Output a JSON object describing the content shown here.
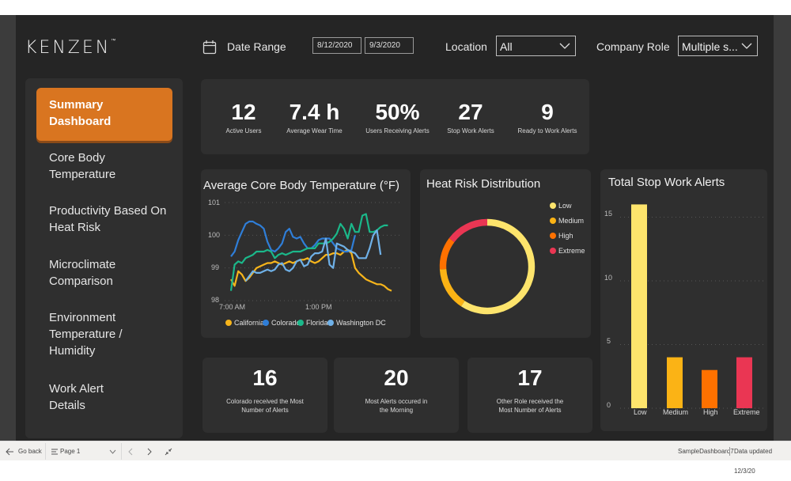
{
  "header": {
    "logo": "KENZEN",
    "logo_mark": "™",
    "date_range_label": "Date Range",
    "date_start": "8/12/2020",
    "date_end": "9/3/2020",
    "location_label": "Location",
    "location_value": "All",
    "role_label": "Company Role",
    "role_value": "Multiple s..."
  },
  "sidebar": {
    "items": [
      {
        "label": "Summary Dashboard",
        "active": true
      },
      {
        "label": "Core Body Temperature"
      },
      {
        "label": "Productivity Based On Heat Risk"
      },
      {
        "label": "Microclimate Comparison"
      },
      {
        "label": "Environment Temperature / Humidity"
      },
      {
        "label": "Work Alert Details"
      }
    ]
  },
  "kpis": [
    {
      "value": "12",
      "label": "Active Users"
    },
    {
      "value": "7.4 h",
      "label": "Average Wear Time"
    },
    {
      "value": "50%",
      "label": "Users Receiving Alerts"
    },
    {
      "value": "27",
      "label": "Stop Work Alerts"
    },
    {
      "value": "9",
      "label": "Ready to Work Alerts"
    }
  ],
  "insights": [
    {
      "value": "16",
      "label": "Colorado received the Most Number of Alerts"
    },
    {
      "value": "20",
      "label": "Most Alerts occured in the Morning"
    },
    {
      "value": "17",
      "label": "Other Role received the Most Number of Alerts"
    }
  ],
  "chart_data": [
    {
      "type": "line",
      "title": "Average Core Body Temperature (°F)",
      "xlabel": "",
      "ylabel": "",
      "ylim": [
        98,
        101
      ],
      "yticks": [
        "101",
        "100",
        "99",
        "98"
      ],
      "xticks": [
        "7:00 AM",
        "1:00 PM"
      ],
      "grid": true,
      "legend_position": "bottom",
      "series": [
        {
          "name": "California",
          "color": "#f7b51b",
          "values": [
            98.65,
            98.45,
            98.9,
            98.8,
            98.6,
            98.7,
            98.85,
            99.0,
            99.05,
            99.1,
            99.15,
            99.15,
            99.2,
            99.15,
            99.1,
            99.15,
            99.2,
            99.15,
            99.2,
            99.25,
            99.25,
            99.3,
            99.2,
            99.15,
            99.2,
            99.3,
            99.4,
            99.4,
            99.45,
            99.45,
            99.4,
            99.5,
            99.55,
            99.45,
            99.0,
            98.85,
            98.75,
            98.65,
            98.6,
            98.55,
            98.5,
            98.5,
            98.45,
            98.35,
            98.3
          ]
        },
        {
          "name": "Colorado",
          "color": "#2f7ed8",
          "values": [
            99.35,
            99.5,
            99.85,
            100.1,
            100.35,
            100.42,
            100.42,
            100.35,
            100.3,
            100.2,
            99.8,
            99.55,
            99.5,
            99.6,
            99.75,
            100.1,
            100.2,
            99.95,
            99.9,
            99.95,
            99.75,
            99.6,
            99.6,
            99.7,
            99.85,
            99.9,
            99.9,
            99.9,
            99.75,
            99.6,
            99.55,
            99.5,
            99.5,
            99.55,
            100.0,
            null,
            null,
            null,
            null,
            null,
            null,
            null,
            null,
            null,
            null
          ]
        },
        {
          "name": "Florida",
          "color": "#1bb88a",
          "values": [
            98.3,
            99.1,
            99.2,
            99.15,
            99.3,
            99.35,
            99.4,
            99.5,
            99.5,
            99.5,
            99.55,
            99.5,
            99.3,
            99.4,
            99.45,
            99.4,
            99.45,
            99.5,
            99.5,
            99.5,
            99.55,
            99.6,
            99.6,
            99.6,
            99.75,
            99.75,
            99.75,
            99.8,
            99.9,
            100.05,
            100.35,
            100.2,
            99.9,
            100.35,
            100.1,
            100.1,
            100.6,
            100.65,
            100.1,
            100.1,
            100.15,
            100.25,
            100.3,
            100.3,
            null
          ]
        },
        {
          "name": "Washington DC",
          "color": "#6fb1e8",
          "values": [
            null,
            null,
            null,
            null,
            98.6,
            98.75,
            98.9,
            98.85,
            98.85,
            98.9,
            98.95,
            98.9,
            98.95,
            99.1,
            99.15,
            98.95,
            98.9,
            99.0,
            99.2,
            99.25,
            99.05,
            99.1,
            99.35,
            99.45,
            99.45,
            99.5,
            99.9,
            99.1,
            99.0,
            99.75,
            99.7,
            99.65,
            99.55,
            99.5,
            99.45,
            99.3,
            99.3,
            99.3,
            99.6,
            100.0,
            100.15,
            99.4,
            null,
            null,
            null
          ]
        }
      ]
    },
    {
      "type": "pie",
      "title": "Heat Risk Distribution",
      "donut": true,
      "legend_position": "top-right",
      "categories": [
        "Low",
        "Medium",
        "High",
        "Extreme"
      ],
      "values": [
        16,
        4,
        3,
        4
      ],
      "colors": [
        "#fde46c",
        "#fbb315",
        "#fe7100",
        "#ea3653"
      ]
    },
    {
      "type": "bar",
      "title": "Total Stop Work Alerts",
      "xlabel": "",
      "ylabel": "",
      "ylim": [
        0,
        16
      ],
      "yticks": [
        "15",
        "10",
        "5",
        "0"
      ],
      "categories": [
        "Low",
        "Medium",
        "High",
        "Extreme"
      ],
      "values": [
        16,
        4,
        3,
        4
      ],
      "colors": [
        "#fde46c",
        "#fbb315",
        "#fe7100",
        "#ea3653"
      ],
      "grid": true
    }
  ],
  "footer": {
    "go_back": "Go back",
    "page": "Page 1",
    "report_name": "SampleDashboard7",
    "data_updated": "Data updated 12/3/20"
  }
}
